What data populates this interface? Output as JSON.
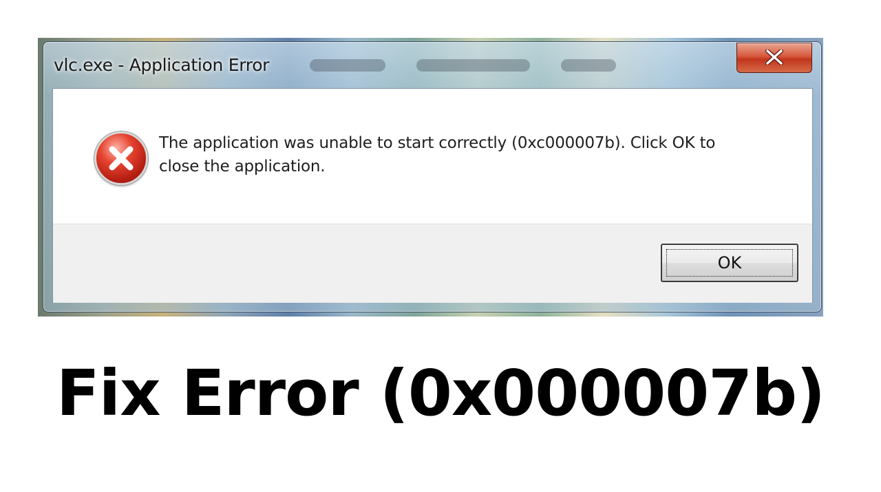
{
  "dialog": {
    "title": "vlc.exe - Application Error",
    "close_icon": "close-icon",
    "icon": "error-icon",
    "message_line1": "The application was unable to start correctly (0xc000007b). Click OK to",
    "message_line2": "close the application.",
    "ok_label": "OK"
  },
  "caption": {
    "text": "Fix Error (0x000007b)"
  },
  "colors": {
    "close_button": "#c2361c",
    "error_icon": "#d4311f",
    "button_area": "#f0f0f0"
  }
}
